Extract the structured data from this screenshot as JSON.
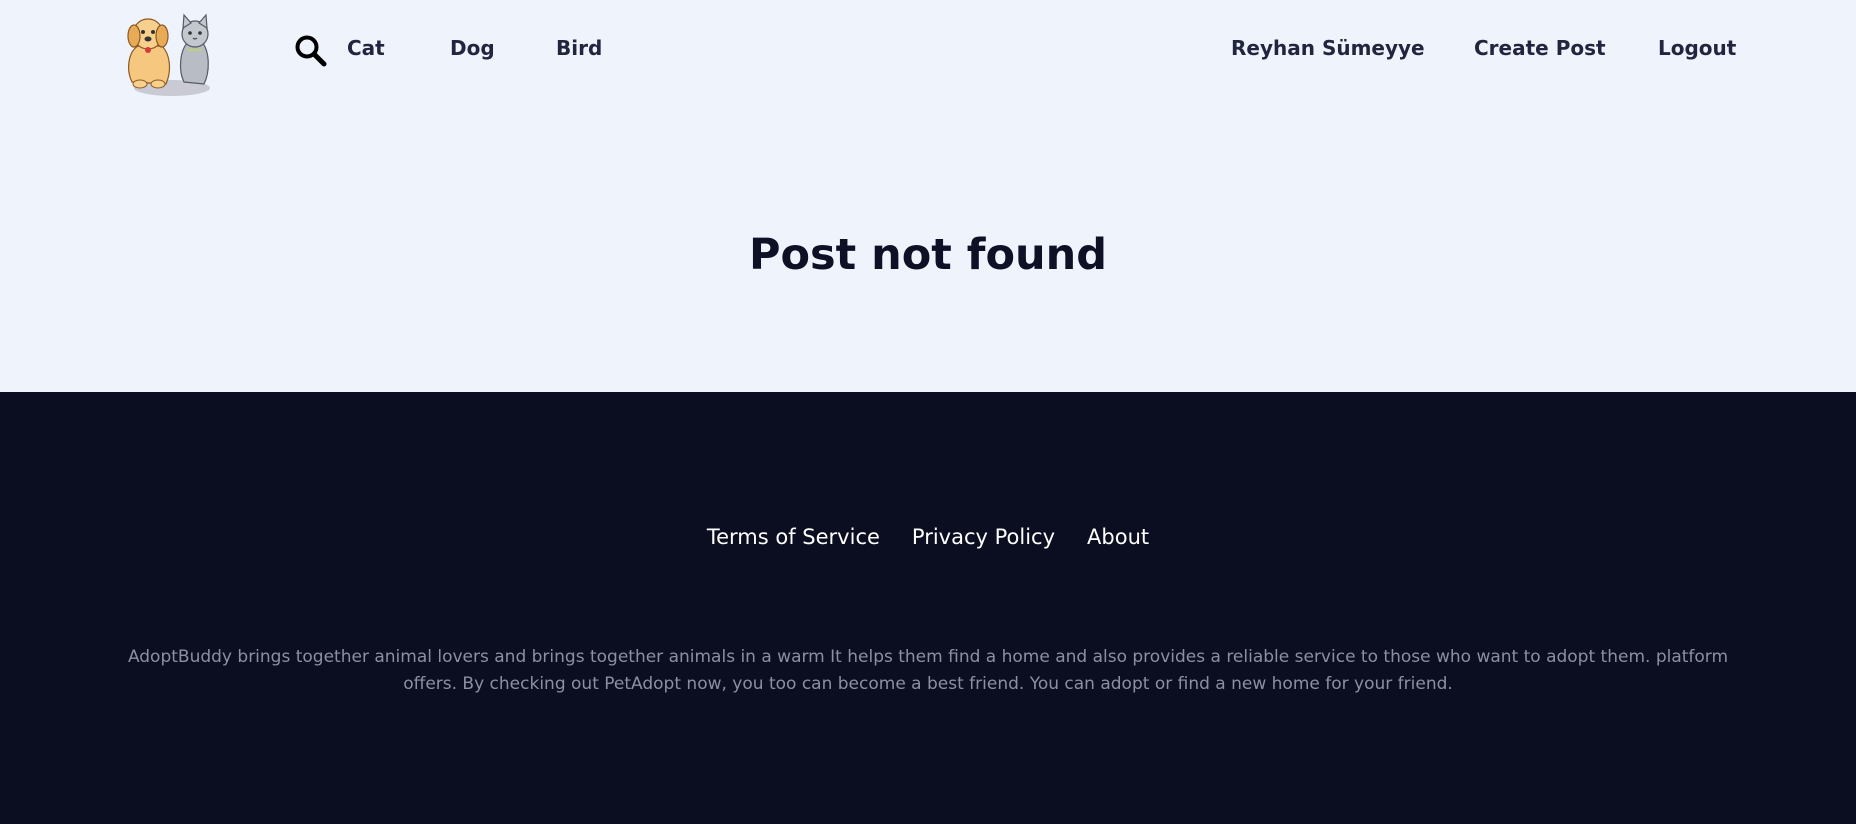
{
  "header": {
    "logo_icon": "dog-and-cat-logo",
    "search_icon": "search-icon",
    "categories": [
      {
        "label": "Cat"
      },
      {
        "label": "Dog"
      },
      {
        "label": "Bird"
      }
    ],
    "user_name": "Reyhan Sümeyye",
    "create_post_label": "Create Post",
    "logout_label": "Logout"
  },
  "main": {
    "title": "Post not found"
  },
  "footer": {
    "links": [
      {
        "label": "Terms of Service"
      },
      {
        "label": "Privacy Policy"
      },
      {
        "label": "About"
      }
    ],
    "description": "AdoptBuddy brings together animal lovers and brings together animals in a warm It helps them find a home and also provides a reliable service to those who want to adopt them. platform offers. By checking out PetAdopt now, you too can become a best friend. You can adopt or find a new home for your friend."
  },
  "colors": {
    "page_background": "#eff3fc",
    "footer_background": "#0b0d21",
    "nav_text": "#22253e",
    "title_text": "#0e1026",
    "footer_link_text": "#ffffff",
    "footer_desc_text": "#8c8fa3"
  }
}
